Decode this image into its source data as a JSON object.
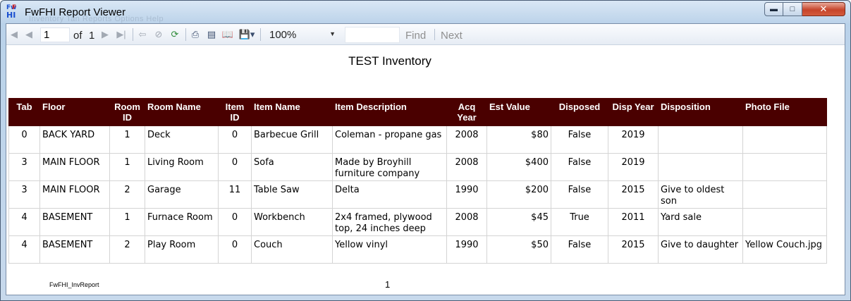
{
  "window": {
    "title": "FwFHI Report Viewer",
    "ghost_menu": "Inventory   Tan   Reports   Options   Help",
    "icon_letters": [
      "Fw",
      "F",
      "HI"
    ]
  },
  "toolbar": {
    "current_page": "1",
    "of_label": "of",
    "total_pages": "1",
    "zoom": "100%",
    "find_label": "Find",
    "next_label": "Next",
    "find_value": ""
  },
  "report": {
    "title": "TEST Inventory",
    "footer_name": "FwFHI_InvReport",
    "footer_page": "1",
    "header_color": "#4a0000",
    "columns": [
      {
        "label": "Tab",
        "align": "c"
      },
      {
        "label": "Floor",
        "align": "l"
      },
      {
        "label": "Room ID",
        "align": "c"
      },
      {
        "label": "Room Name",
        "align": "l"
      },
      {
        "label": "Item ID",
        "align": "c"
      },
      {
        "label": "Item Name",
        "align": "l"
      },
      {
        "label": "Item Description",
        "align": "l"
      },
      {
        "label": "Acq Year",
        "align": "c"
      },
      {
        "label": "Est Value",
        "align": "l"
      },
      {
        "label": "Disposed",
        "align": "c"
      },
      {
        "label": "Disp Year",
        "align": "c"
      },
      {
        "label": "Disposition",
        "align": "l"
      },
      {
        "label": "Photo File",
        "align": "l"
      }
    ],
    "rows": [
      [
        "0",
        "BACK YARD",
        "1",
        "Deck",
        "0",
        "Barbecue Grill",
        "Coleman - propane gas",
        "2008",
        "$80",
        "False",
        "2019",
        "",
        ""
      ],
      [
        "3",
        "MAIN FLOOR",
        "1",
        "Living Room",
        "0",
        "Sofa",
        "Made by Broyhill furniture company",
        "2008",
        "$400",
        "False",
        "2019",
        "",
        ""
      ],
      [
        "3",
        "MAIN FLOOR",
        "2",
        "Garage",
        "11",
        "Table Saw",
        "Delta",
        "1990",
        "$200",
        "False",
        "2015",
        "Give to oldest son",
        ""
      ],
      [
        "4",
        "BASEMENT",
        "1",
        "Furnace Room",
        "0",
        "Workbench",
        "2x4 framed, plywood top, 24 inches deep",
        "2008",
        "$45",
        "True",
        "2011",
        "Yard sale",
        ""
      ],
      [
        "4",
        "BASEMENT",
        "2",
        "Play Room",
        "0",
        "Couch",
        "Yellow vinyl",
        "1990",
        "$50",
        "False",
        "2015",
        "Give to daughter",
        "Yellow Couch.jpg"
      ]
    ]
  }
}
